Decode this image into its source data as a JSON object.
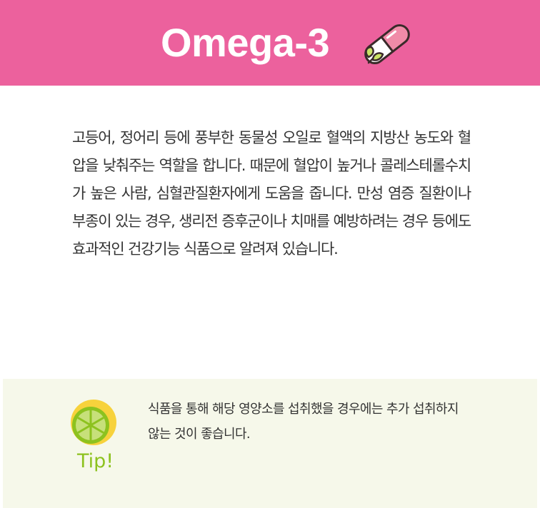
{
  "header": {
    "title": "Omega-3",
    "icon": "capsule-with-leaf-icon",
    "background_color": "#EC619D"
  },
  "description": {
    "text": "고등어, 정어리 등에 풍부한 동물성 오일로 혈액의 지방산 농도와 혈압을 낮춰주는 역할을 합니다. 때문에 혈압이 높거나 콜레스테롤수치가 높은 사람, 심혈관질환자에게 도움을 줍니다. 만성 염증 질환이나 부종이 있는 경우, 생리전 증후군이나 치매를 예방하려는 경우 등에도 효과적인 건강기능 식품으로 알려져 있습니다."
  },
  "tip": {
    "icon": "lime-slice-icon",
    "label": "Tip!",
    "text": "식품을 통해 해당 영양소를 섭취했을 경우에는 추가 섭취하지 않는 것이 좋습니다.",
    "background_color": "#F6F8EA",
    "accent_color": "#8DC21F"
  }
}
